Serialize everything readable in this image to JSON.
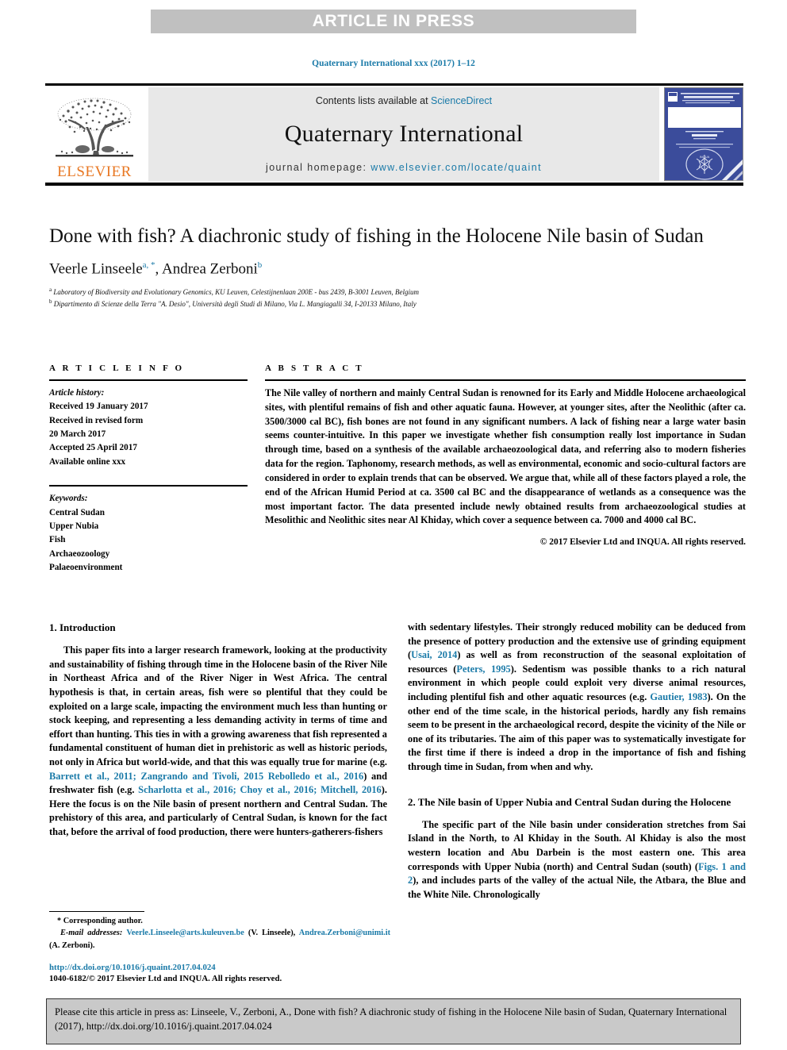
{
  "banner": {
    "label": "ARTICLE IN PRESS"
  },
  "running_head": {
    "text": "Quaternary International xxx (2017) 1–12"
  },
  "masthead": {
    "contents_prefix": "Contents lists available at ",
    "contents_link": "ScienceDirect",
    "journal_name": "Quaternary International",
    "homepage_prefix": "journal homepage: ",
    "homepage_link": "www.elsevier.com/locate/quaint",
    "publisher_wordmark": "ELSEVIER",
    "cover_title": "QUATERNARY INTERNATIONAL"
  },
  "article": {
    "title": "Done with fish? A diachronic study of fishing in the Holocene Nile basin of Sudan",
    "authors_part1": "Veerle Linseele",
    "authors_sup1": "a, *",
    "authors_part2": ", Andrea Zerboni",
    "authors_sup2": "b",
    "affiliation_a_sup": "a",
    "affiliation_a": " Laboratory of Biodiversity and Evolutionary Genomics, KU Leuven, Celestijnenlaan 200E - bus 2439, B-3001 Leuven, Belgium",
    "affiliation_b_sup": "b",
    "affiliation_b": " Dipartimento di Scienze della Terra \"A. Desio\", Università degli Studi di Milano, Via L. Mangiagalli 34, I-20133 Milano, Italy"
  },
  "article_info": {
    "heading": "A R T I C L E   I N F O",
    "history_label": "Article history:",
    "history": [
      "Received 19 January 2017",
      "Received in revised form",
      "20 March 2017",
      "Accepted 25 April 2017",
      "Available online xxx"
    ],
    "keywords_label": "Keywords:",
    "keywords": [
      "Central Sudan",
      "Upper Nubia",
      "Fish",
      "Archaeozoology",
      "Palaeoenvironment"
    ]
  },
  "abstract": {
    "heading": "A B S T R A C T",
    "text": "The Nile valley of northern and mainly Central Sudan is renowned for its Early and Middle Holocene archaeological sites, with plentiful remains of fish and other aquatic fauna. However, at younger sites, after the Neolithic (after ca. 3500/3000 cal BC), fish bones are not found in any significant numbers. A lack of fishing near a large water basin seems counter-intuitive. In this paper we investigate whether fish consumption really lost importance in Sudan through time, based on a synthesis of the available archaeozoological data, and referring also to modern fisheries data for the region. Taphonomy, research methods, as well as environmental, economic and socio-cultural factors are considered in order to explain trends that can be observed. We argue that, while all of these factors played a role, the end of the African Humid Period at ca. 3500 cal BC and the disappearance of wetlands as a consequence was the most important factor. The data presented include newly obtained results from archaeozoological studies at Mesolithic and Neolithic sites near Al Khiday, which cover a sequence between ca. 7000 and 4000 cal BC.",
    "copyright": "© 2017 Elsevier Ltd and INQUA. All rights reserved."
  },
  "sections": {
    "intro_heading": "1. Introduction",
    "intro_p1_a": "This paper fits into a larger research framework, looking at the productivity and sustainability of fishing through time in the Holocene basin of the River Nile in Northeast Africa and of the River Niger in West Africa. The central hypothesis is that, in certain areas, fish were so plentiful that they could be exploited on a large scale, impacting the environment much less than hunting or stock keeping, and representing a less demanding activity in terms of time and effort than hunting. This ties in with a growing awareness that fish represented a fundamental constituent of human diet in prehistoric as well as historic periods, not only in Africa but world-wide, and that this was equally true for marine (e.g. ",
    "intro_ref1": "Barrett et al., 2011; Zangrando and Tivoli, 2015 Rebolledo et al., 2016",
    "intro_p1_b": ") and freshwater fish (e.g. ",
    "intro_ref2": "Scharlotta et al., 2016; Choy et al., 2016; Mitchell, 2016",
    "intro_p1_c": "). Here the focus is on the Nile basin of present northern and Central Sudan. The prehistory of this area, and particularly of Central Sudan, is known for the fact that, before the arrival of food production, there were hunters-gatherers-fishers",
    "intro_p2_a": "with sedentary lifestyles. Their strongly reduced mobility can be deduced from the presence of pottery production and the extensive use of grinding equipment (",
    "intro_ref3": "Usai, 2014",
    "intro_p2_b": ") as well as from reconstruction of the seasonal exploitation of resources (",
    "intro_ref4": "Peters, 1995",
    "intro_p2_c": "). Sedentism was possible thanks to a rich natural environment in which people could exploit very diverse animal resources, including plentiful fish and other aquatic resources (e.g. ",
    "intro_ref5": "Gautier, 1983",
    "intro_p2_d": "). On the other end of the time scale, in the historical periods, hardly any fish remains seem to be present in the archaeological record, despite the vicinity of the Nile or one of its tributaries. The aim of this paper was to systematically investigate for the first time if there is indeed a drop in the importance of fish and fishing through time in Sudan, from when and why.",
    "nile_heading": "2. The Nile basin of Upper Nubia and Central Sudan during the Holocene",
    "nile_p1_a": "The specific part of the Nile basin under consideration stretches from Sai Island in the North, to Al Khiday in the South. Al Khiday is also the most western location and Abu Darbein is the most eastern one. This area corresponds with Upper Nubia (north) and Central Sudan (south) (",
    "nile_ref1": "Figs. 1 and 2",
    "nile_p1_b": "), and includes parts of the valley of the actual Nile, the Atbara, the Blue and the White Nile. Chronologically"
  },
  "footnotes": {
    "corresponding": "* Corresponding author.",
    "email_label": "E-mail addresses:",
    "email1": "Veerle.Linseele@arts.kuleuven.be",
    "email1_name": " (V. Linseele), ",
    "email2": "Andrea.Zerboni@unimi.it",
    "email2_name": " (A. Zerboni).",
    "doi": "http://dx.doi.org/10.1016/j.quaint.2017.04.024",
    "issn": "1040-6182/© 2017 Elsevier Ltd and INQUA. All rights reserved."
  },
  "cite_box": {
    "text": "Please cite this article in press as: Linseele, V., Zerboni, A., Done with fish? A diachronic study of fishing in the Holocene Nile basin of Sudan, Quaternary International (2017), http://dx.doi.org/10.1016/j.quaint.2017.04.024"
  },
  "colors": {
    "link": "#1a7aa8",
    "banner_bg": "#c0c0c0",
    "masthead_bg": "#e8e8e8",
    "elsevier_orange": "#e87722",
    "cite_bg": "#c9c9c9"
  }
}
